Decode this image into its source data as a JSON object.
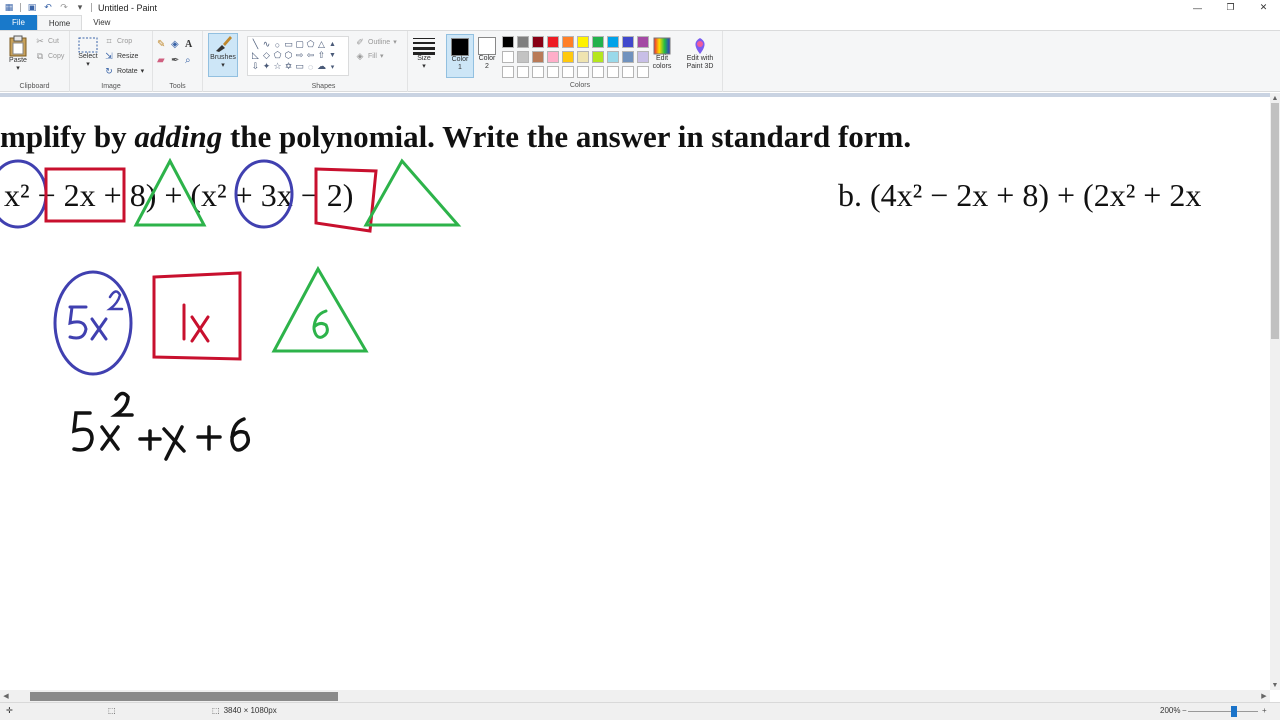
{
  "window": {
    "title": "Untitled - Paint"
  },
  "tabs": {
    "file": "File",
    "home": "Home",
    "view": "View"
  },
  "ribbon": {
    "clipboard": {
      "label": "Clipboard",
      "paste": "Paste",
      "cut": "Cut",
      "copy": "Copy"
    },
    "image": {
      "label": "Image",
      "select": "Select",
      "crop": "Crop",
      "resize": "Resize",
      "rotate": "Rotate"
    },
    "tools": {
      "label": "Tools"
    },
    "brushes": {
      "label": "Brushes"
    },
    "shapes": {
      "label": "Shapes",
      "outline": "Outline",
      "fill": "Fill"
    },
    "size": {
      "label": "Size"
    },
    "colors": {
      "label": "Colors",
      "color1_label": "Color 1",
      "color2_label": "Color 2",
      "color1": "#000000",
      "color2": "#ffffff",
      "edit_colors": "Edit colors",
      "edit_with_paint3d": "Edit with Paint 3D",
      "palette": [
        "#000000",
        "#7f7f7f",
        "#880015",
        "#ed1c24",
        "#ff7f27",
        "#fff200",
        "#22b14c",
        "#00a2e8",
        "#3f48cc",
        "#a349a4",
        "#ffffff",
        "#c3c3c3",
        "#b97a57",
        "#ffaec9",
        "#ffc90e",
        "#efe4b0",
        "#b5e61d",
        "#99d9ea",
        "#7092be",
        "#c8bfe7",
        "#ffffff",
        "#ffffff",
        "#ffffff",
        "#ffffff",
        "#ffffff",
        "#ffffff",
        "#ffffff",
        "#ffffff",
        "#ffffff",
        "#ffffff"
      ]
    }
  },
  "canvas": {
    "title_prefix": "mplify by ",
    "title_emph": "adding",
    "title_suffix": " the polynomial. Write the answer in standard form.",
    "expr_a": "x² − 2x + 8) + (x² + 3x − 2)",
    "expr_b": "b. (4x² − 2x + 8) + (2x² + 2x",
    "annotation_colors": {
      "circle": "#4040b0",
      "square": "#c8102e",
      "triangle": "#2db34a",
      "ink": "#111111"
    }
  },
  "status": {
    "dimensions": "3840 × 1080px",
    "zoom": "200%"
  }
}
